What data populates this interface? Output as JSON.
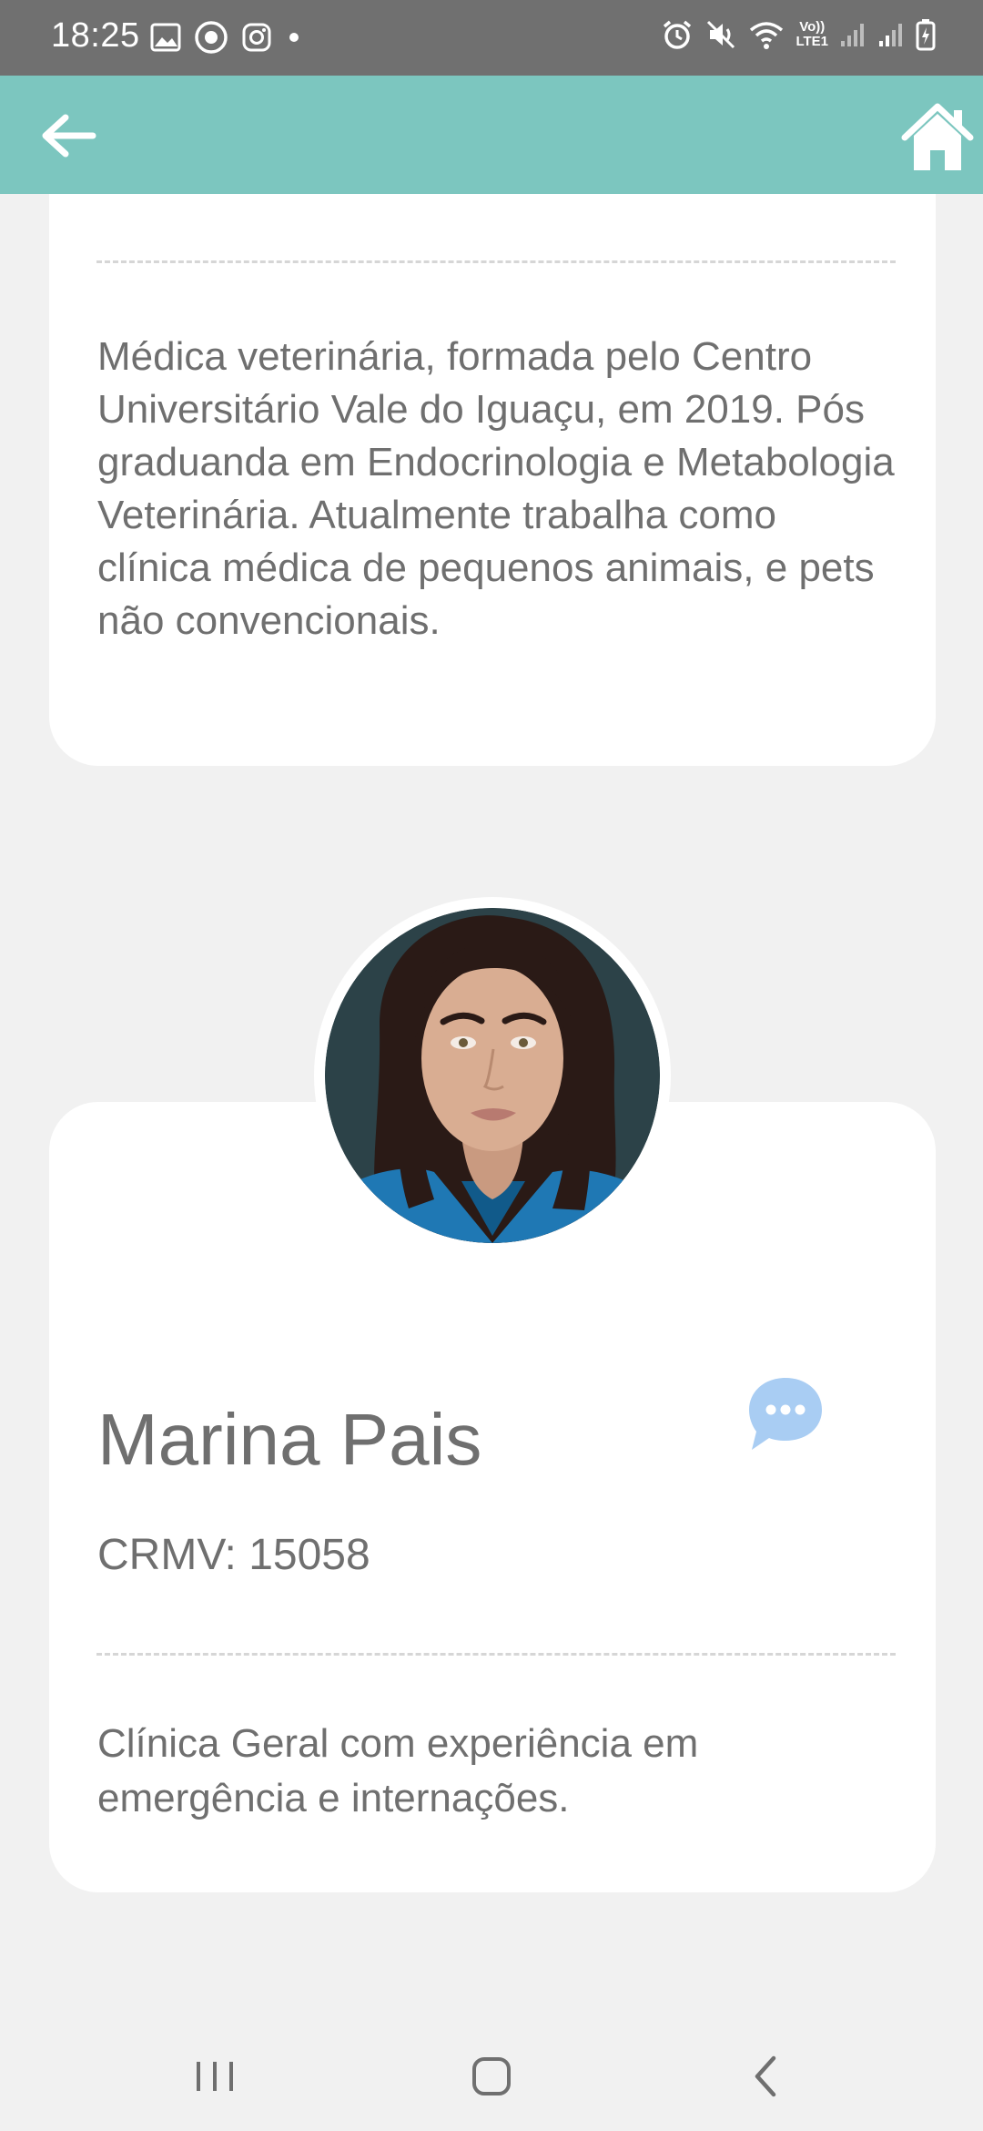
{
  "status_bar": {
    "time": "18:25",
    "lte_label_top": "Vo))",
    "lte_label_bottom": "LTE1",
    "left_icons": [
      "image-icon",
      "record-icon",
      "instagram-icon",
      "dot-icon"
    ],
    "right_icons": [
      "alarm-icon",
      "mute-icon",
      "wifi-icon",
      "signal-icon",
      "signal-icon",
      "battery-charging-icon"
    ]
  },
  "app_bar": {
    "color": "#7cc6bf",
    "back_icon": "arrow-left-icon",
    "home_icon": "home-icon"
  },
  "bio_card": {
    "text": "Médica veterinária, formada pelo Centro Universitário Vale do Iguaçu, em 2019. Pós graduanda em Endocrinologia e Metabologia Veterinária. Atualmente trabalha como clínica médica de pequenos animais, e pets não convencionais."
  },
  "profile_card": {
    "name": "Marina Pais",
    "crmv": "CRMV: 15058",
    "specialty": "Clínica Geral com experiência em emergência e internações.",
    "chat_icon": "chat-bubble-icon",
    "chat_color": "#a9cdf3"
  },
  "nav_bar": {
    "icons": [
      "recents-icon",
      "home-circle-icon",
      "back-chevron-icon"
    ]
  }
}
